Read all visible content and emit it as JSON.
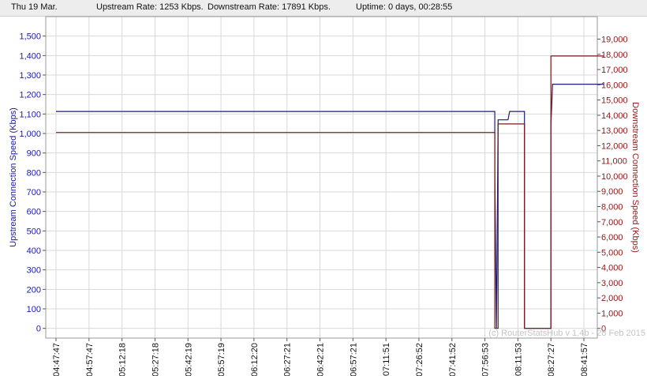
{
  "header": {
    "date": "Thu 19 Mar.",
    "upstream_rate": "Upstream Rate: 1253 Kbps.",
    "downstream_rate": "Downstream Rate: 17891 Kbps.",
    "uptime": "Uptime: 0 days, 00:28:55"
  },
  "watermark": "(c) RouterStatsHub v 1.4b - 28 Feb 2015",
  "colors": {
    "upstream": "#1a1a7a",
    "downstream": "#7a1a1a",
    "left_axis": "#1a1aa0",
    "right_axis": "#8b1a1a",
    "grid": "#d9d9d9"
  },
  "chart_data": {
    "type": "line",
    "xlabel": "",
    "x_ticks": [
      "04:47:47",
      "04:57:47",
      "05:12:18",
      "05:27:18",
      "05:42:19",
      "05:57:19",
      "06:12:20",
      "06:27:21",
      "06:42:21",
      "06:57:21",
      "07:11:51",
      "07:26:52",
      "07:41:52",
      "07:56:53",
      "08:11:53",
      "08:27:27",
      "08:41:57"
    ],
    "y_left": {
      "label": "Upstream Connection Speed (Kbps)",
      "ylim": [
        -50,
        1600
      ],
      "ticks": [
        0,
        100,
        200,
        300,
        400,
        500,
        600,
        700,
        800,
        900,
        1000,
        1100,
        1200,
        1300,
        1400,
        1500
      ],
      "tick_labels": [
        "0",
        "100",
        "200",
        "300",
        "400",
        "500",
        "600",
        "700",
        "800",
        "900",
        "1,000",
        "1,100",
        "1,200",
        "1,300",
        "1,400",
        "1,500"
      ]
    },
    "y_right": {
      "label": "Downstream Connection Speed (Kbps)",
      "ylim": [
        -640,
        20480
      ],
      "ticks": [
        0,
        1000,
        2000,
        3000,
        4000,
        5000,
        6000,
        7000,
        8000,
        9000,
        10000,
        11000,
        12000,
        13000,
        14000,
        15000,
        16000,
        17000,
        18000,
        19000
      ],
      "tick_labels": [
        "0",
        "1,000",
        "2,000",
        "3,000",
        "4,000",
        "5,000",
        "6,000",
        "7,000",
        "8,000",
        "9,000",
        "10,000",
        "11,000",
        "12,000",
        "13,000",
        "14,000",
        "15,000",
        "16,000",
        "17,000",
        "18,000",
        "19,000"
      ]
    },
    "grid": true,
    "series": [
      {
        "axis": "left",
        "color": "#1a1a7a",
        "points": [
          [
            0,
            1113
          ],
          [
            13.3,
            1113
          ],
          [
            13.3,
            800
          ],
          [
            13.35,
            0
          ],
          [
            13.4,
            1070
          ],
          [
            13.7,
            1070
          ],
          [
            13.75,
            1113
          ],
          [
            14.2,
            1113
          ],
          [
            14.2,
            0
          ],
          [
            15.0,
            0
          ],
          [
            15.0,
            1040
          ],
          [
            15.05,
            1253
          ],
          [
            16.6,
            1253
          ]
        ]
      },
      {
        "axis": "right",
        "color": "#7a1a1a",
        "points": [
          [
            0,
            12870
          ],
          [
            13.3,
            12870
          ],
          [
            13.3,
            0
          ],
          [
            13.4,
            0
          ],
          [
            13.4,
            13430
          ],
          [
            14.2,
            13430
          ],
          [
            14.2,
            0
          ],
          [
            15.0,
            0
          ],
          [
            15.0,
            17891
          ],
          [
            16.6,
            17891
          ]
        ]
      }
    ]
  }
}
